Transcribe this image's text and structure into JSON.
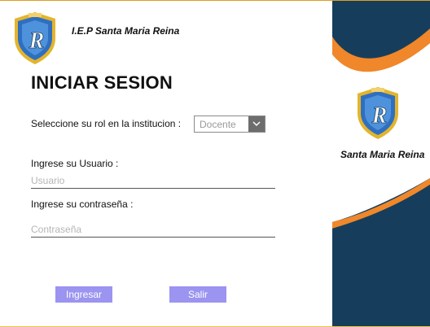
{
  "header": {
    "school_title": "I.E.P Santa Maria Reina",
    "logo_letter": "R"
  },
  "form": {
    "heading": "INICIAR SESION",
    "role_label": "Seleccione su rol en la institucion :",
    "role_selected": "Docente",
    "user_label": "Ingrese su Usuario :",
    "user_placeholder": "Usuario",
    "user_value": "",
    "password_label": "Ingrese su contraseña :",
    "password_placeholder": "Contraseña",
    "password_value": ""
  },
  "buttons": {
    "login_label": "Ingresar",
    "exit_label": "Salir"
  },
  "side_panel": {
    "brand_name": "Santa Maria Reina",
    "logo_letter": "R"
  },
  "colors": {
    "panel_bg": "#163e5c",
    "wave_orange": "#f0872a",
    "button_bg": "#9b94f0",
    "shield_blue": "#2f6fc2",
    "shield_gold": "#e3b52c"
  },
  "icons": {
    "dropdown": "chevron-down-icon",
    "logo": "shield-crest-icon"
  }
}
